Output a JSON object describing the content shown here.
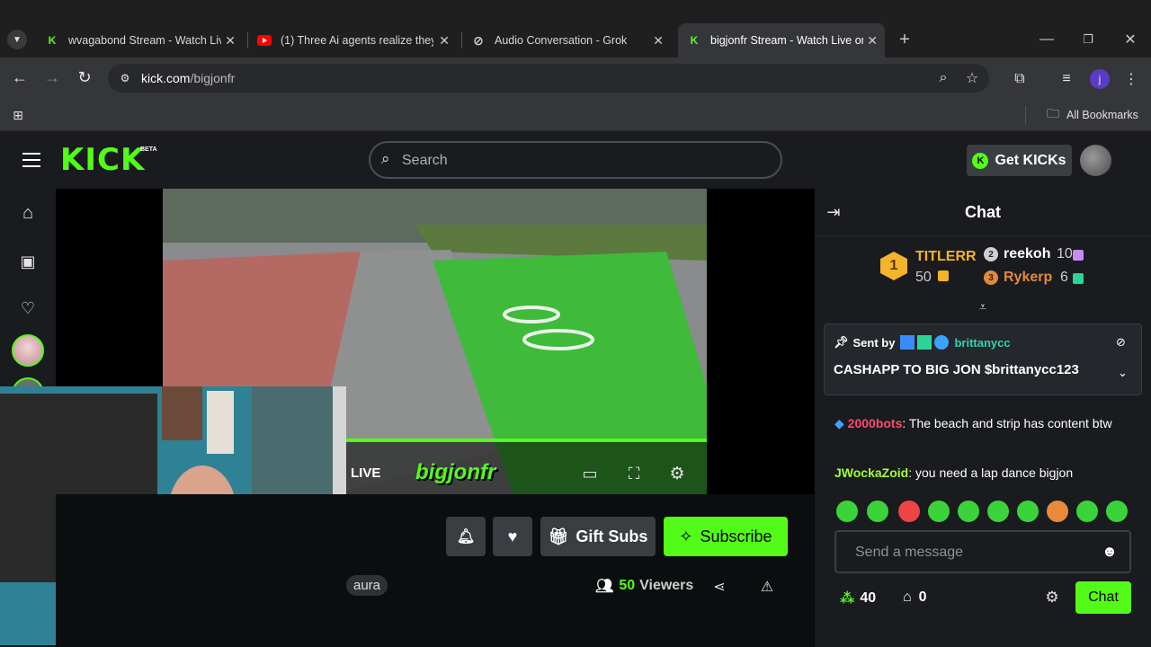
{
  "browser": {
    "tabs": [
      {
        "title": "wvagabond Stream - Watch Live",
        "favicon": "kick-logo"
      },
      {
        "title": "(1) Three Ai agents realize they",
        "favicon": "youtube-logo"
      },
      {
        "title": "Audio Conversation - Grok",
        "favicon": "grok-logo"
      },
      {
        "title": "bigjonfr Stream - Watch Live on",
        "favicon": "kick-logo"
      }
    ],
    "url_domain": "kick.com",
    "url_path": "/bigjonfr",
    "bookmarks_label": "All Bookmarks",
    "profile_initial": "j"
  },
  "kick": {
    "logo": "KICK",
    "beta": "BETA",
    "search_placeholder": "Search",
    "get_kicks": "Get KICKs"
  },
  "player": {
    "live_label": "LIVE",
    "watermark": "bigjonfr"
  },
  "channel": {
    "gift_subs": "Gift Subs",
    "subscribe": "Subscribe",
    "tag": "aura",
    "viewers_count": "50",
    "viewers_label": "Viewers"
  },
  "chat": {
    "title": "Chat",
    "leaderboard": [
      {
        "rank": "1",
        "name": "TITLERR",
        "count": "50"
      },
      {
        "rank": "2",
        "name": "reekoh",
        "count": "10"
      },
      {
        "rank": "3",
        "name": "Rykerp",
        "count": "6"
      }
    ],
    "pinned": {
      "sent_by": "Sent by",
      "user": "brittanycc",
      "message": "CASHAPP TO BIG JON $brittanycc123"
    },
    "messages": [
      {
        "user": "2000bots",
        "text": ": The beach and strip has content btw"
      },
      {
        "user": "JWockaZoid",
        "text": ": you need a lap dance bigjon"
      }
    ],
    "input_placeholder": "Send a message",
    "points": "40",
    "shop_count": "0",
    "send_label": "Chat"
  },
  "colors": {
    "kick_green": "#53fc18",
    "bg": "#0b0e0f",
    "panel": "#191b1f"
  }
}
